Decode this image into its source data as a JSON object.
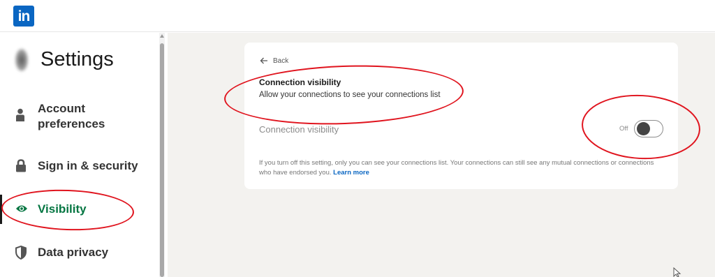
{
  "brand": {
    "logo_text": "in",
    "color": "#0a66c2"
  },
  "sidebar": {
    "title": "Settings",
    "items": [
      {
        "label": "Account preferences",
        "icon": "person-icon",
        "active": false
      },
      {
        "label": "Sign in & security",
        "icon": "lock-icon",
        "active": false
      },
      {
        "label": "Visibility",
        "icon": "eye-icon",
        "active": true
      },
      {
        "label": "Data privacy",
        "icon": "shield-icon",
        "active": false
      }
    ],
    "active_color": "#057642"
  },
  "panel": {
    "back_label": "Back",
    "title": "Connection visibility",
    "subtitle": "Allow your connections to see your connections list",
    "setting_label": "Connection visibility",
    "toggle_state": "Off",
    "note_text": "If you turn off this setting, only you can see your connections list. Your connections can still see any mutual connections or connections who have endorsed you.",
    "learn_more": "Learn more"
  },
  "annotations": {
    "color": "#e0141e"
  }
}
